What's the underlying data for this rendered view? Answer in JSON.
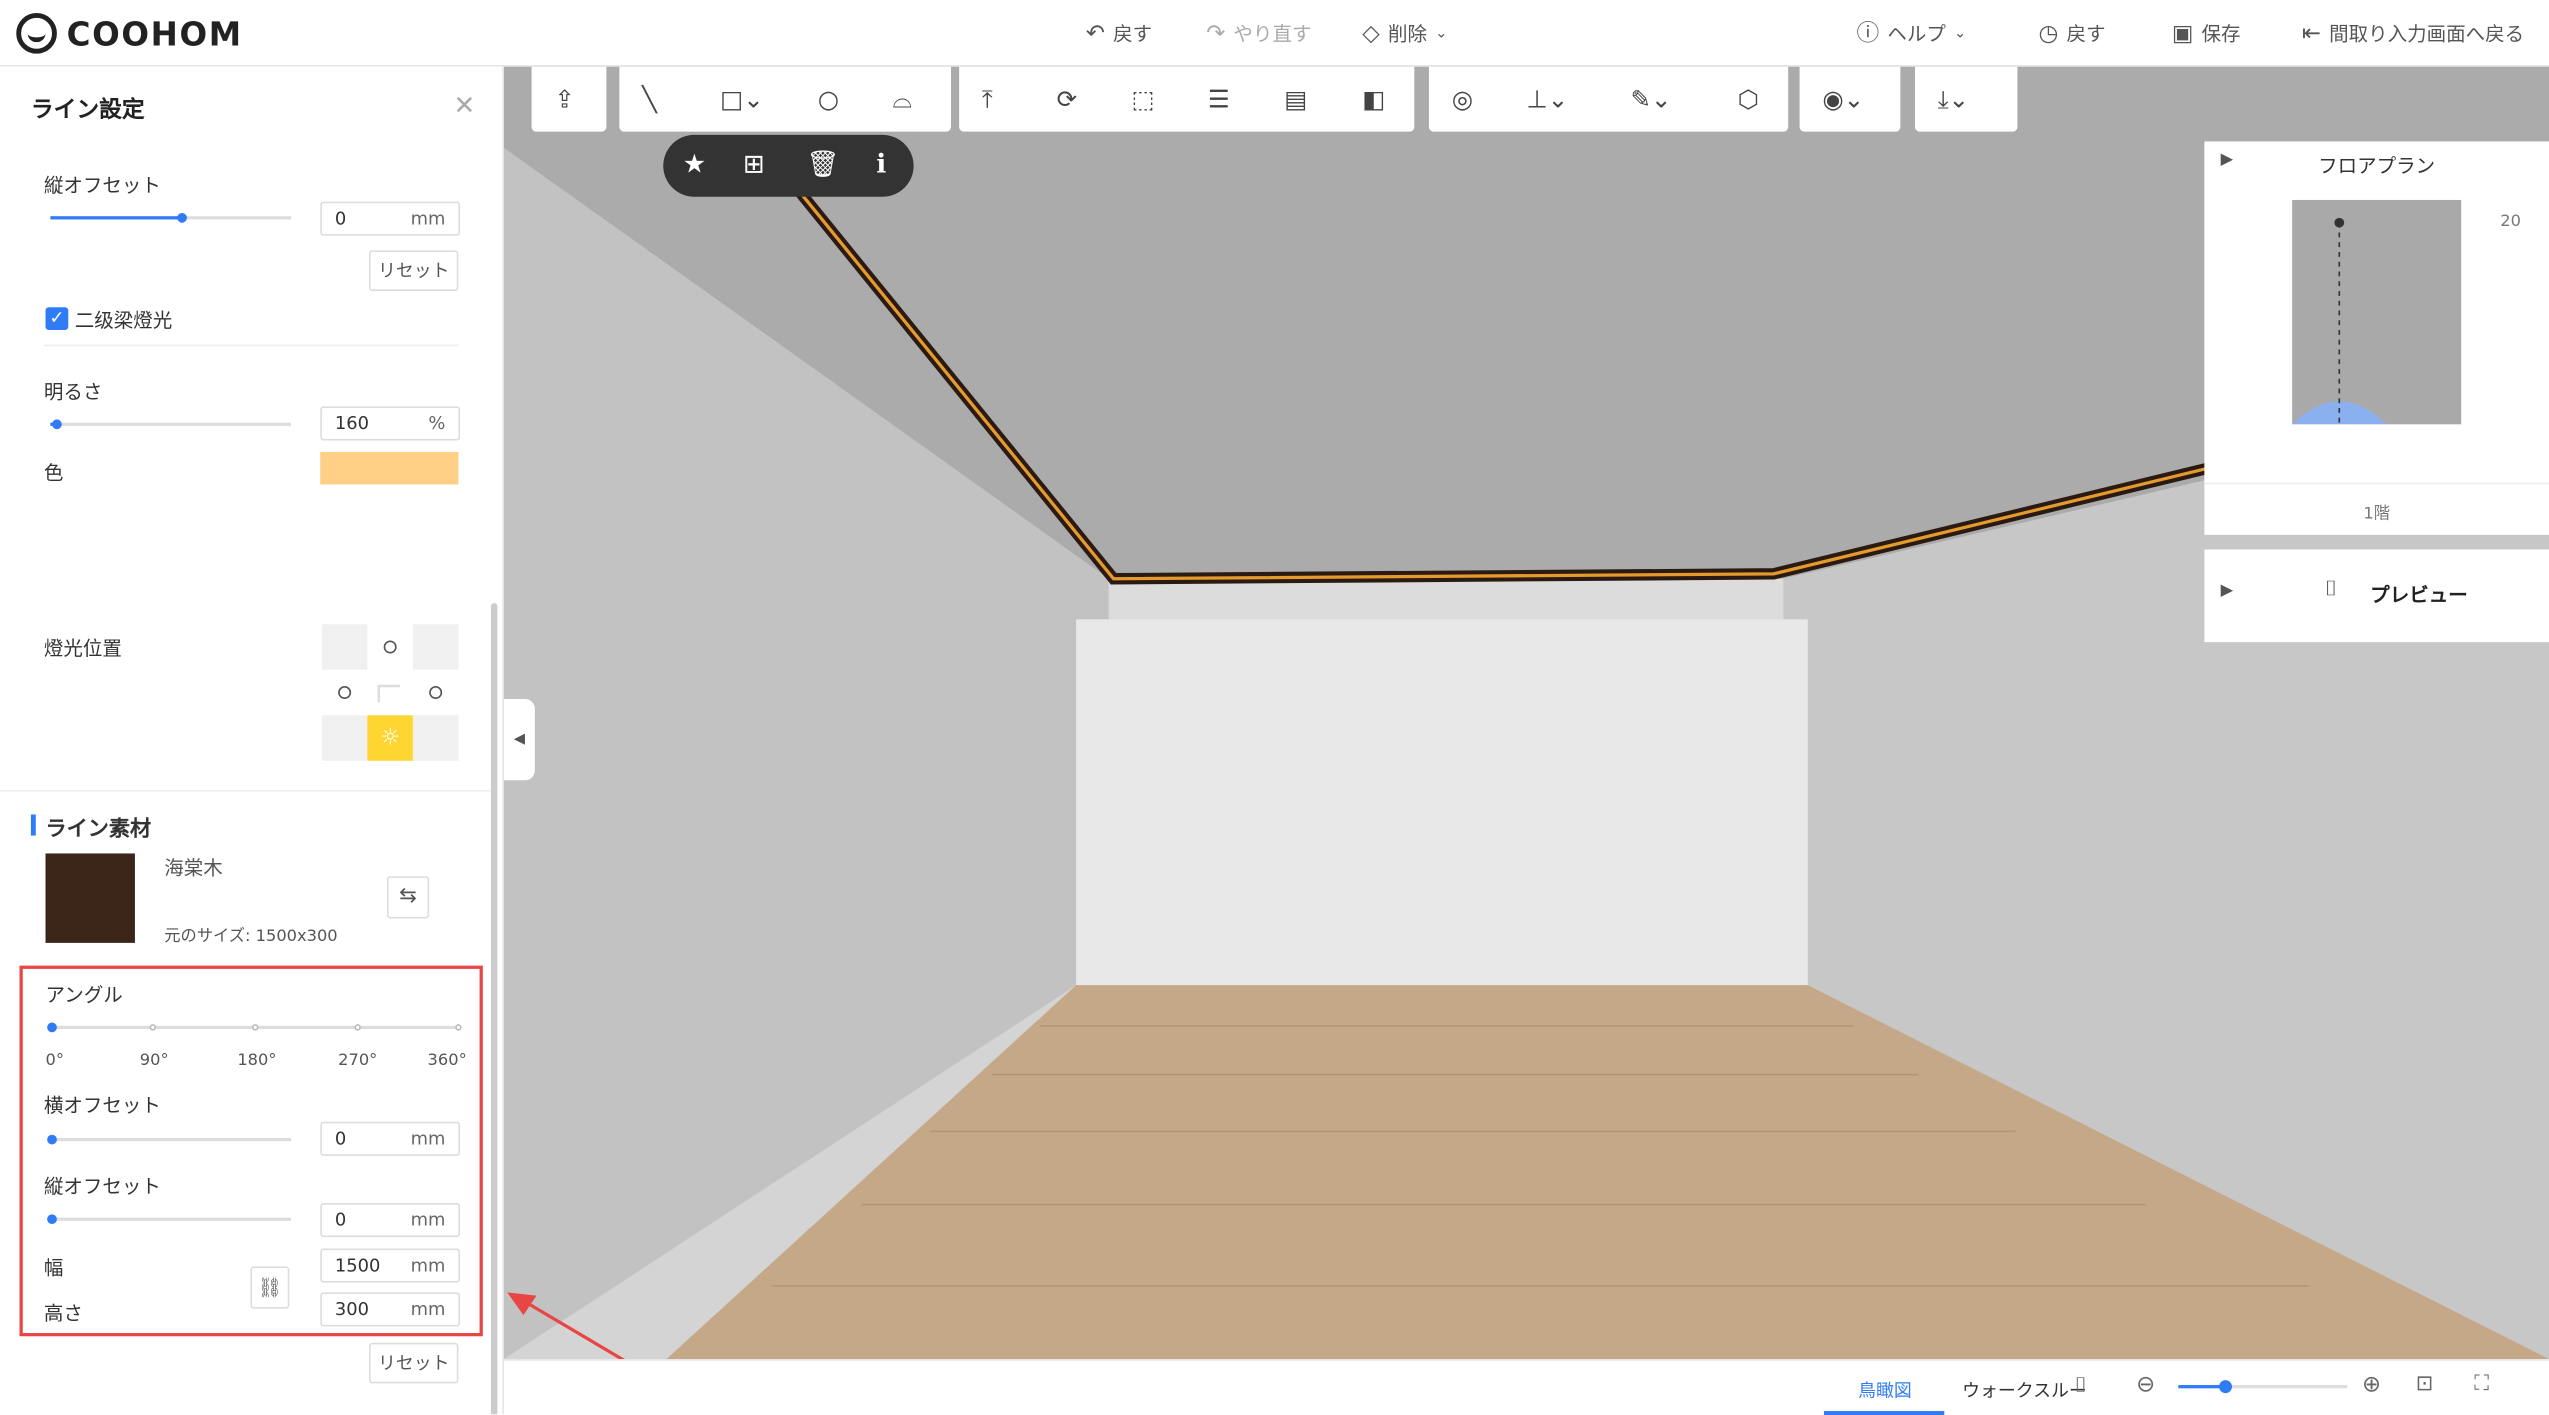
{
  "app": {
    "logo_text": "COOHOM"
  },
  "topbar": {
    "undo": "戻す",
    "redo": "やり直す",
    "delete": "削除",
    "help": "ヘルプ",
    "history": "戻す",
    "save": "保存",
    "back_to_floorplan": "間取り入力画面へ戻る"
  },
  "panel": {
    "title": "ライン設定",
    "upper": {
      "vertical_offset_label": "縦オフセット",
      "vertical_offset_value": "0",
      "vertical_offset_unit": "mm",
      "vertical_offset_level": 0.55,
      "reset_label": "リセット"
    },
    "secondary_light": {
      "checked": true,
      "label": "二级梁燈光"
    },
    "brightness": {
      "label": "明るさ",
      "value": "160",
      "unit": "%",
      "level": 0.03
    },
    "color": {
      "label": "色",
      "value": "#ffcf86"
    },
    "light_position": {
      "label": "燈光位置",
      "selected": "bottom"
    },
    "material": {
      "section_title": "ライン素材",
      "name": "海棠木",
      "size_text": "元のサイズ: 1500x300",
      "swatch_color": "#3b2418"
    },
    "angle": {
      "label": "アングル",
      "ticks": [
        "0°",
        "90°",
        "180°",
        "270°",
        "360°"
      ],
      "value": 0
    },
    "h_offset": {
      "label": "横オフセット",
      "value": "0",
      "unit": "mm",
      "level": 0
    },
    "v_offset": {
      "label": "縦オフセット",
      "value": "0",
      "unit": "mm",
      "level": 0
    },
    "width": {
      "label": "幅",
      "value": "1500",
      "unit": "mm"
    },
    "height": {
      "label": "高さ",
      "value": "300",
      "unit": "mm"
    },
    "reset_label": "リセット"
  },
  "floorplan": {
    "title": "フロアプラン",
    "level": "1階",
    "scale_label": "20"
  },
  "preview": {
    "label": "プレビュー"
  },
  "bottombar": {
    "tab_birdseye": "鳥瞰図",
    "tab_walkthrough": "ウォークスルー",
    "zoom_level": 0.27
  },
  "colors": {
    "accent": "#2f7cf6",
    "highlight": "#e84545",
    "sun": "#ffd531"
  }
}
